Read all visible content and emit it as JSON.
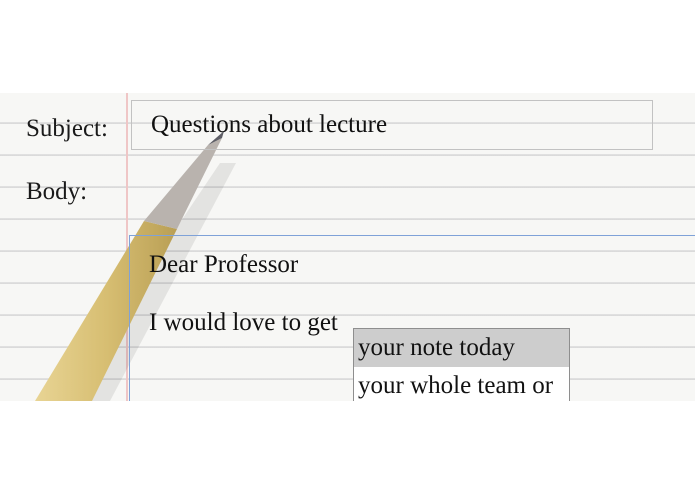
{
  "form": {
    "subject_label": "Subject:",
    "subject_value": "Questions about lecture",
    "body_label": "Body:"
  },
  "body": {
    "greeting": "Dear Professor",
    "typed_text": "I would love to get"
  },
  "autocomplete": {
    "options": [
      {
        "label": "your note today",
        "selected": true
      },
      {
        "label": "your whole team or",
        "selected": false
      }
    ]
  },
  "colors": {
    "editor_focus_border": "#7fa2d8",
    "selected_option": "#cdcdcd",
    "margin_line": "#efc6c6"
  }
}
